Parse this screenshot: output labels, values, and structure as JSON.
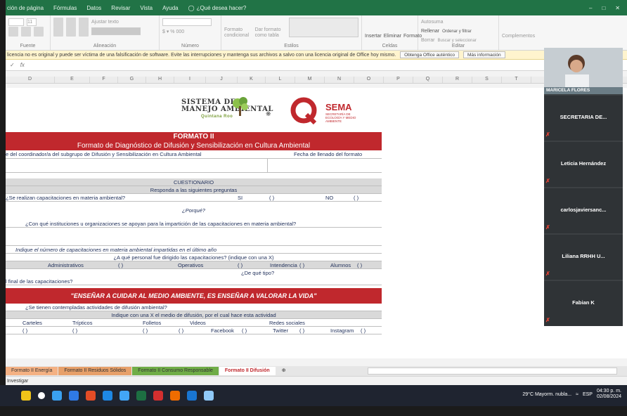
{
  "menu": {
    "items": [
      "ción de página",
      "Fórmulas",
      "Datos",
      "Revisar",
      "Vista",
      "Ayuda"
    ],
    "tell_me": "¿Qué desea hacer?"
  },
  "ribbon": {
    "font_size": "11",
    "wrap_text": "Ajustar texto",
    "groups": [
      "Fuente",
      "Alineación",
      "Número",
      "Estilos",
      "Celdas",
      "Editar"
    ],
    "conditional": "Formato condicional",
    "as_table": "Dar formato como tabla",
    "insert": "Insertar",
    "delete": "Eliminar",
    "format": "Formato",
    "autosum": "Autosuma",
    "fill": "Rellenar",
    "clear": "Borrar",
    "sort": "Ordenar y filtrar",
    "find": "Buscar y seleccionar",
    "addins": "Complementos"
  },
  "warning": {
    "text": "licencia no es original y puede ser víctima de una falsificación de software. Evite las interrupciones y mantenga sus archivos a salvo con una licencia original de Office hoy mismo.",
    "btn_get": "Obtenga Office auténtico",
    "btn_info": "Más información"
  },
  "formula_bar": {
    "fx": "fx"
  },
  "columns": [
    "D",
    "E",
    "F",
    "G",
    "H",
    "I",
    "J",
    "K",
    "L",
    "M",
    "N",
    "O",
    "P",
    "Q",
    "R",
    "S",
    "T"
  ],
  "form": {
    "logo_sma_1": "SISTEMA DE",
    "logo_sma_2": "MANEJO AMBIENTAL",
    "logo_sma_sub": "Quintana Roo",
    "sema_title": "SEMA",
    "sema_sub": "SECRETARÍA DE ECOLOGÍA Y MEDIO AMBIENTE",
    "formato": "FORMATO II",
    "title": "Formato de Diagnóstico de Difusión y Sensibilización en Cultura Ambiental",
    "coordinator": "e del coordinador/a del subgrupo de Difusión y Sensibilización en Cultura  Ambiental",
    "fecha": "Fecha de llenado del formato",
    "cuestionario": "CUESTIONARIO",
    "responda": "Responda a las siguientes preguntas",
    "q1": "¿Se realizan capacitaciones en materia ambiental?",
    "si": "SI",
    "no": "NO",
    "paren": "(          )",
    "porque": "¿Porqué?",
    "q2": "¿Con qué instituciones u organizaciones se apoyan para la impartición de las capacitaciones en materia ambiental?",
    "q3": "Indique el número de capacitaciones en materia ambiental impartidas en el último año",
    "q4": "¿A qué personal fue dirigido las capacitaciones? (indique con una X)",
    "administrativos": "Administrativos",
    "operativos": "Operativos",
    "intendencia": "Intendencia",
    "alumnos": "Alumnos",
    "q5": "l final de las capacitaciones?",
    "q5b": "¿De qué tipo?",
    "slogan": "\"ENSEÑAR A CUIDAR AL MEDIO AMBIENTE, ES ENSEÑAR A VALORAR LA VIDA\"",
    "q6": "¿Se tienen contempladas actividades de difusión ambiental?",
    "q7": "Indique con una X el medio de difusión, por el cual hace esta actividad",
    "carteles": "Carteles",
    "tripticos": "Trípticos",
    "folletos": "Folletos",
    "videos": "Videos",
    "redes": "Redes sociales",
    "facebook": "Facebook",
    "twitter": "Twitter",
    "instagram": "Instagram"
  },
  "tabs": [
    {
      "label": "Formato II Energía",
      "color": "#f4b183"
    },
    {
      "label": "Formato II Residuos Sólidos",
      "color": "#e7a06a"
    },
    {
      "label": "Formato II Consumo Responsable",
      "color": "#70ad47"
    },
    {
      "label": "Formato II Difusión",
      "color": "#ffffff"
    }
  ],
  "status": "Investigar",
  "meet": {
    "participants": [
      "MARICELA FLORES",
      "SECRETARIA DE...",
      "Leticia Hernández",
      "carlosjaviersanc...",
      "Liliana RRHH U...",
      "Fabian K"
    ]
  },
  "taskbar": {
    "weather": "29°C  Mayorm. nubla...",
    "lang": "ESP",
    "time": "04:30 p. m.",
    "date": "02/08/2024"
  }
}
